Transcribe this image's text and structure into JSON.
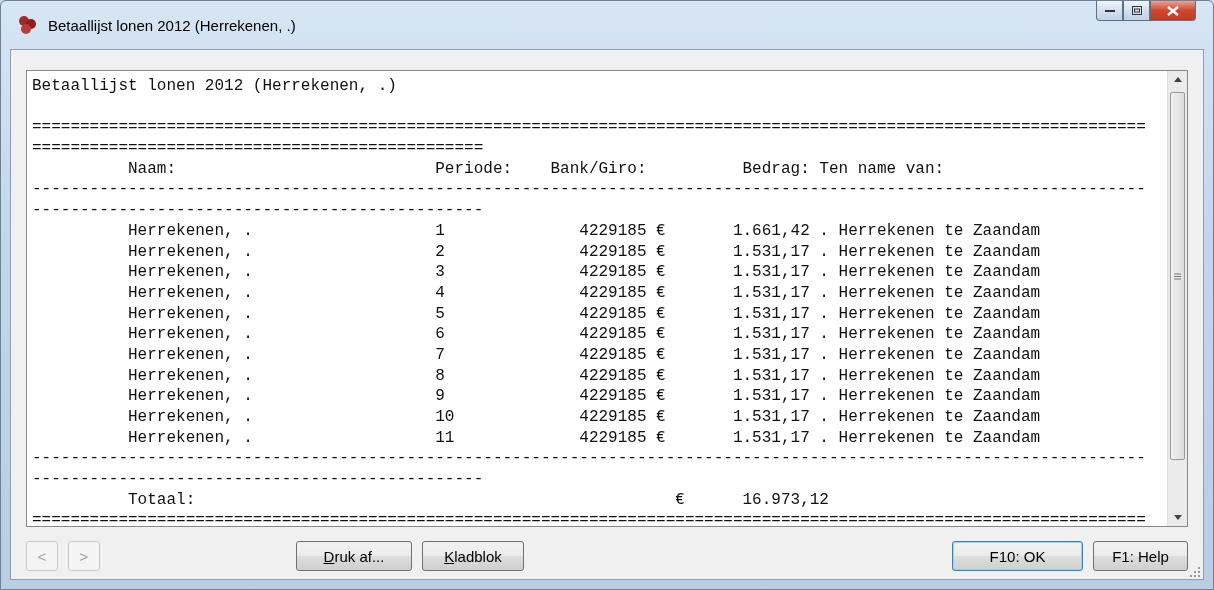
{
  "window": {
    "title": "Betaallijst lonen 2012 (Herrekenen, .)"
  },
  "report": {
    "title": "Betaallijst lonen 2012 (Herrekenen, .)",
    "lines": [
      "====================================================================================================================",
      "===============================================",
      "          Naam:                           Periode:    Bank/Giro:          Bedrag: Ten name van:",
      "--------------------------------------------------------------------------------------------------------------------",
      "-----------------------------------------------",
      "          Herrekenen, .                   1              4229185 €       1.661,42 . Herrekenen te Zaandam",
      "          Herrekenen, .                   2              4229185 €       1.531,17 . Herrekenen te Zaandam",
      "          Herrekenen, .                   3              4229185 €       1.531,17 . Herrekenen te Zaandam",
      "          Herrekenen, .                   4              4229185 €       1.531,17 . Herrekenen te Zaandam",
      "          Herrekenen, .                   5              4229185 €       1.531,17 . Herrekenen te Zaandam",
      "          Herrekenen, .                   6              4229185 €       1.531,17 . Herrekenen te Zaandam",
      "          Herrekenen, .                   7              4229185 €       1.531,17 . Herrekenen te Zaandam",
      "          Herrekenen, .                   8              4229185 €       1.531,17 . Herrekenen te Zaandam",
      "          Herrekenen, .                   9              4229185 €       1.531,17 . Herrekenen te Zaandam",
      "          Herrekenen, .                   10             4229185 €       1.531,17 . Herrekenen te Zaandam",
      "          Herrekenen, .                   11             4229185 €       1.531,17 . Herrekenen te Zaandam",
      "--------------------------------------------------------------------------------------------------------------------",
      "-----------------------------------------------",
      "          Totaal:                                                  €      16.973,12",
      "===================================================================================================================="
    ]
  },
  "nav_buttons": [
    {
      "label": "<",
      "disabled": true
    },
    {
      "label": ">",
      "disabled": true
    }
  ],
  "buttons": [
    {
      "label": "Druk af...",
      "underline_first": true,
      "default": false
    },
    {
      "label": "Kladblok",
      "underline_first": true,
      "default": false
    }
  ],
  "dialog_buttons": [
    {
      "label": "F10: OK",
      "underline_first": false,
      "default": true
    },
    {
      "label": "F1: Help",
      "underline_first": false,
      "default": false
    }
  ]
}
